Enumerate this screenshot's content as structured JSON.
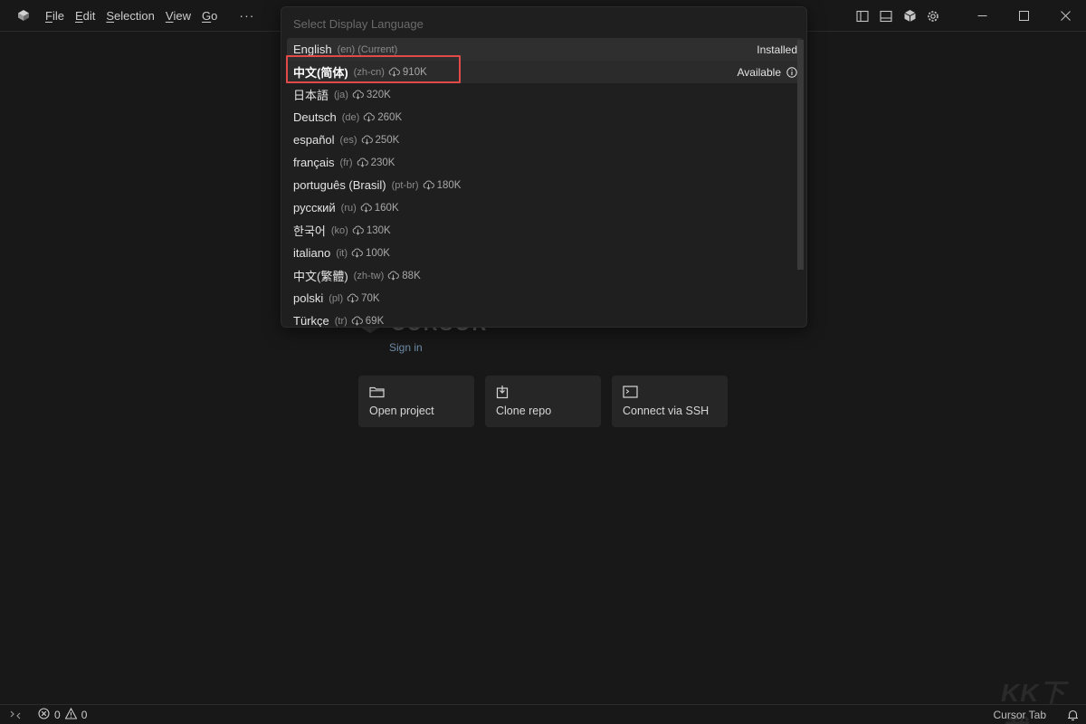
{
  "menu": {
    "items": [
      "File",
      "Edit",
      "Selection",
      "View",
      "Go"
    ],
    "underline": [
      "F",
      "E",
      "S",
      "V",
      "G"
    ],
    "rest": [
      "ile",
      "dit",
      "election",
      "iew",
      "o"
    ],
    "more": "···"
  },
  "quickpick": {
    "placeholder": "Select Display Language",
    "languages": [
      {
        "name": "English",
        "code": "(en) (Current)",
        "size": "",
        "status": "Installed"
      },
      {
        "name": "中文(简体)",
        "code": "(zh-cn)",
        "size": "910K",
        "status": "Available"
      },
      {
        "name": "日本語",
        "code": "(ja)",
        "size": "320K",
        "status": ""
      },
      {
        "name": "Deutsch",
        "code": "(de)",
        "size": "260K",
        "status": ""
      },
      {
        "name": "español",
        "code": "(es)",
        "size": "250K",
        "status": ""
      },
      {
        "name": "français",
        "code": "(fr)",
        "size": "230K",
        "status": ""
      },
      {
        "name": "português (Brasil)",
        "code": "(pt-br)",
        "size": "180K",
        "status": ""
      },
      {
        "name": "русский",
        "code": "(ru)",
        "size": "160K",
        "status": ""
      },
      {
        "name": "한국어",
        "code": "(ko)",
        "size": "130K",
        "status": ""
      },
      {
        "name": "italiano",
        "code": "(it)",
        "size": "100K",
        "status": ""
      },
      {
        "name": "中文(繁體)",
        "code": "(zh-tw)",
        "size": "88K",
        "status": ""
      },
      {
        "name": "polski",
        "code": "(pl)",
        "size": "70K",
        "status": ""
      },
      {
        "name": "Türkçe",
        "code": "(tr)",
        "size": "69K",
        "status": ""
      }
    ]
  },
  "welcome": {
    "brand": "CURSOR",
    "sign_in": "Sign in",
    "actions": [
      {
        "label": "Open project",
        "icon": "folder-icon"
      },
      {
        "label": "Clone repo",
        "icon": "clone-icon"
      },
      {
        "label": "Connect via SSH",
        "icon": "terminal-icon"
      }
    ]
  },
  "statusbar": {
    "errors": "0",
    "warnings": "0",
    "cursor_tab": "Cursor Tab"
  },
  "watermark": "KK下载",
  "colors": {
    "background": "#181818",
    "highlight": "#e24a4a",
    "link": "#6f8ba8"
  }
}
